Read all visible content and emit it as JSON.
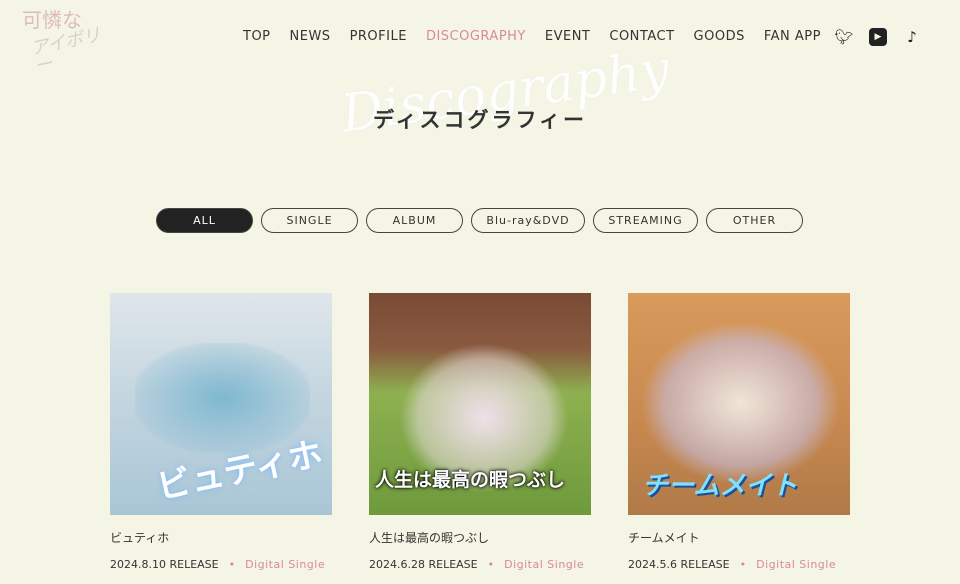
{
  "logo": {
    "text_1": "可憐な",
    "text_2": "アイボリー"
  },
  "nav": {
    "items": [
      "TOP",
      "NEWS",
      "PROFILE",
      "DISCOGRAPHY",
      "EVENT",
      "CONTACT",
      "GOODS",
      "FAN APP"
    ],
    "active": "DISCOGRAPHY"
  },
  "social": [
    "twitter-icon",
    "youtube-icon",
    "tiktok-icon"
  ],
  "page": {
    "script_title": "Discography",
    "title": "ディスコグラフィー"
  },
  "filters": [
    "ALL",
    "SINGLE",
    "ALBUM",
    "Blu-ray&DVD",
    "STREAMING",
    "OTHER"
  ],
  "active_filter": "ALL",
  "releases": [
    {
      "title": "ビュティホ",
      "date": "2024.8.10 RELEASE",
      "type": "Digital Single",
      "cover_text": "ビュティホ"
    },
    {
      "title": "人生は最高の暇つぶし",
      "date": "2024.6.28 RELEASE",
      "type": "Digital Single",
      "cover_text": "人生は最高の暇つぶし"
    },
    {
      "title": "チームメイト",
      "date": "2024.5.6 RELEASE",
      "type": "Digital Single",
      "cover_text": "チームメイト"
    }
  ],
  "colors": {
    "background": "#f5f5e6",
    "accent": "#d98a97",
    "dark": "#222222"
  }
}
